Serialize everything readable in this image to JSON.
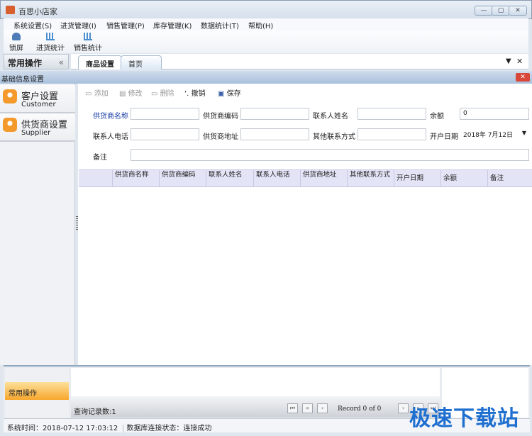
{
  "window": {
    "title": "百思小店家",
    "controls": [
      "—",
      "▢",
      "✕"
    ]
  },
  "menu": [
    "系统设置(S)",
    "进货管理(I)",
    "销售管理(P)",
    "库存管理(K)",
    "数据统计(T)",
    "帮助(H)"
  ],
  "toolbar": [
    "锁屏",
    "进货统计",
    "销售统计"
  ],
  "left_panel": {
    "title": "常用操作",
    "collapse": "«"
  },
  "tabs": [
    "商品设置",
    "首页"
  ],
  "tab_controls": {
    "dropdown": "▼",
    "close": "✕"
  },
  "section": {
    "title": "基础信息设置",
    "close": "✕"
  },
  "nav": [
    {
      "title": "客户设置",
      "subtitle": "Customer"
    },
    {
      "title": "供货商设置",
      "subtitle": "Supplier"
    }
  ],
  "actions": [
    "添加",
    "修改",
    "删除",
    "撤销",
    "保存"
  ],
  "form": {
    "supplier_name": {
      "label": "供货商名称",
      "value": ""
    },
    "supplier_code": {
      "label": "供货商编码",
      "value": ""
    },
    "contact_name": {
      "label": "联系人姓名",
      "value": ""
    },
    "balance": {
      "label": "余额",
      "value": "0"
    },
    "contact_phone": {
      "label": "联系人电话",
      "value": ""
    },
    "supplier_address": {
      "label": "供货商地址",
      "value": ""
    },
    "other_contact": {
      "label": "其他联系方式",
      "value": ""
    },
    "open_date": {
      "label": "开户日期",
      "value": "2018年 7月12日"
    },
    "remark": {
      "label": "备注",
      "value": ""
    }
  },
  "grid": {
    "columns": [
      "供货商名称",
      "供货商编码",
      "联系人姓名",
      "联系人电话",
      "供货商地址",
      "其他联系方式",
      "开户日期",
      "余额",
      "备注"
    ],
    "rows": []
  },
  "bottom": {
    "panel_label": "常用操作",
    "record_count": "查询记录数:1",
    "record_text": "Record 0 of 0",
    "nav_buttons": [
      "⏮",
      "«",
      "‹",
      "›",
      "»",
      "⏭"
    ]
  },
  "status": {
    "time": "系统时间：2018-07-12 17:03:12",
    "db": "数据库连接状态：连接成功"
  },
  "watermark": "极速下载站",
  "colors": {
    "accent_orange": "#f7a72d",
    "header_blue": "#a9c0dc",
    "highlight_label": "#1a3ea8"
  }
}
